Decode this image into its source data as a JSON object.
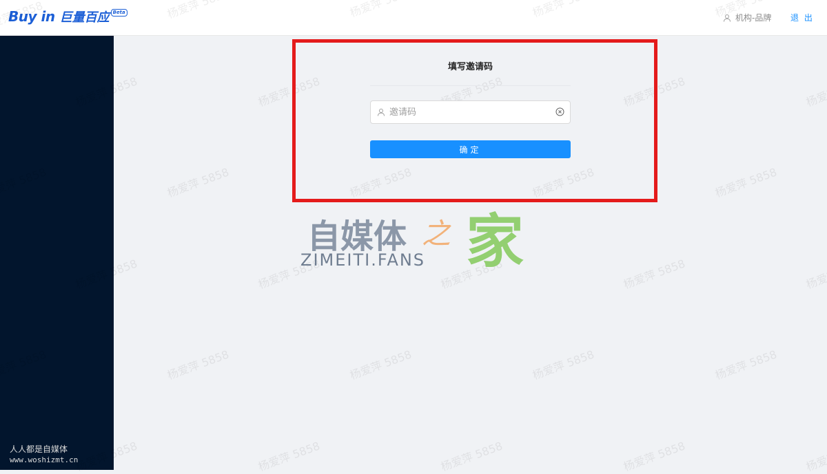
{
  "header": {
    "logo_text": "Buy in",
    "logo_cn": "巨量百应",
    "logo_badge": "Beta",
    "user_icon": "user-icon",
    "user_label": "机构-品牌",
    "logout_label": "退 出"
  },
  "dialog": {
    "title": "填写邀请码",
    "input_icon": "user-icon",
    "input_placeholder": "邀请码",
    "input_value": "",
    "clear_icon": "close-circle-icon",
    "confirm_label": "确定",
    "highlight_color": "#e41b1b",
    "button_color": "#1890ff"
  },
  "sidebar": {
    "background": "#02152d",
    "footer_line1": "人人都是自媒体",
    "footer_line2": "www.woshizmt.cn"
  },
  "overlay_logo": {
    "main": "自媒体",
    "connector": "之",
    "home": "家",
    "subtitle": "ZIMEITI.FANS"
  },
  "watermark": {
    "text": "杨爱萍 5858"
  }
}
